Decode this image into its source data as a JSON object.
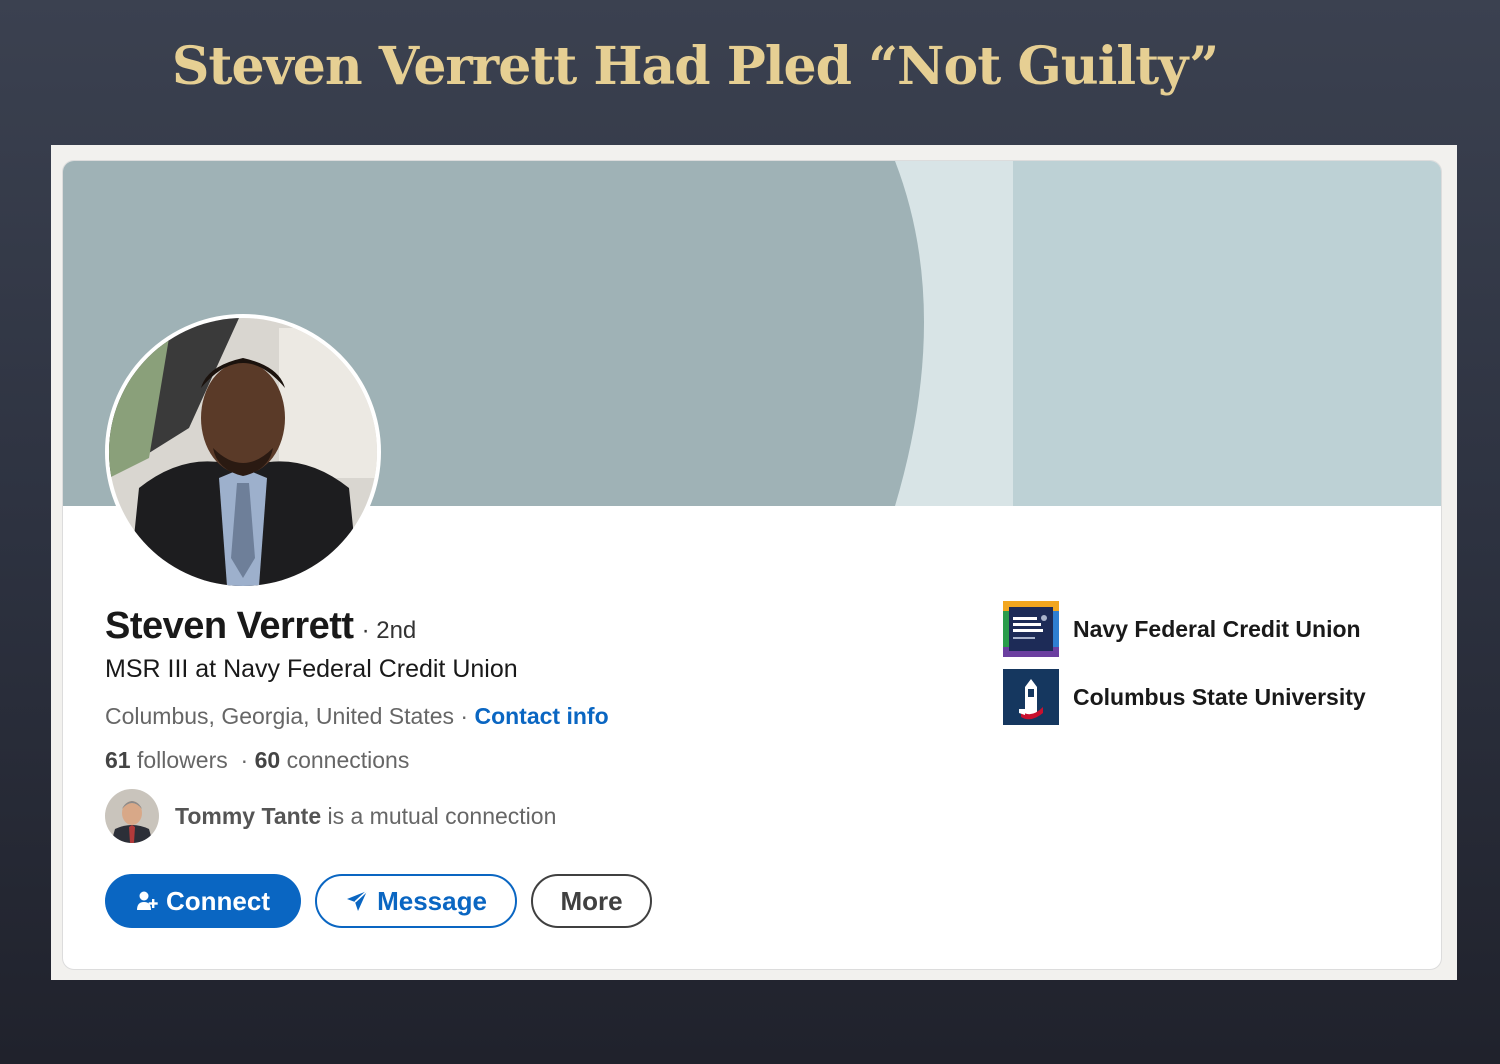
{
  "slide": {
    "title": "Steven Verrett Had Pled “Not Guilty”"
  },
  "colors": {
    "title_gold": "#e6cf93",
    "linkedin_blue": "#0a66c2",
    "banner_dark": "#9fb2b6",
    "banner_light": "#d8e4e6",
    "banner_right": "#bdd1d5"
  },
  "profile": {
    "name": "Steven Verrett",
    "degree": "· 2nd",
    "headline": "MSR III at Navy Federal Credit Union",
    "location": "Columbus, Georgia, United States",
    "separator": " · ",
    "contact_info_label": "Contact info",
    "followers_count": "61",
    "followers_label": " followers",
    "connections_separator": " · ",
    "connections_count": "60",
    "connections_label": " connections",
    "mutual": {
      "name": "Tommy Tante",
      "text": " is a mutual connection"
    }
  },
  "actions": {
    "connect_label": "Connect",
    "message_label": "Message",
    "more_label": "More",
    "connect_icon": "add-person-icon",
    "message_icon": "send-icon"
  },
  "organizations": [
    {
      "name": "Navy Federal Credit Union",
      "logo": "navy-federal-logo"
    },
    {
      "name": "Columbus State University",
      "logo": "columbus-state-logo"
    }
  ]
}
